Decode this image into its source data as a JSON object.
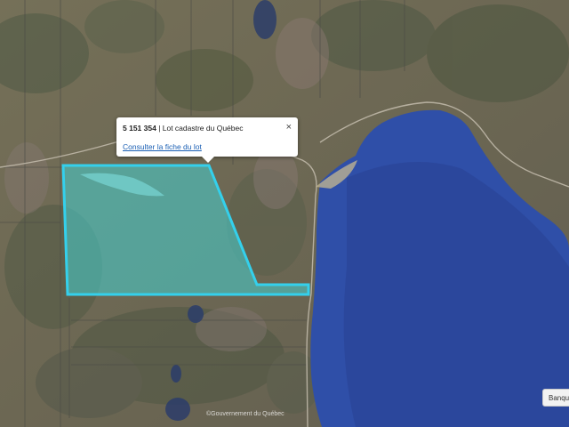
{
  "popup": {
    "lot_number": "5 151 354",
    "lot_type": " | Lot cadastre du Québec",
    "link_label": "Consulter la fiche du lot",
    "close_label": "×"
  },
  "attribution": "©Gouvernement du Québec",
  "side_button": {
    "label": "Banque"
  },
  "colors": {
    "lake": "#2f4fa8",
    "parcel_fill": "#46d2d2",
    "parcel_stroke": "#34d0ec",
    "terrain": "#6f6a5a"
  },
  "icons": [
    "close-icon"
  ]
}
